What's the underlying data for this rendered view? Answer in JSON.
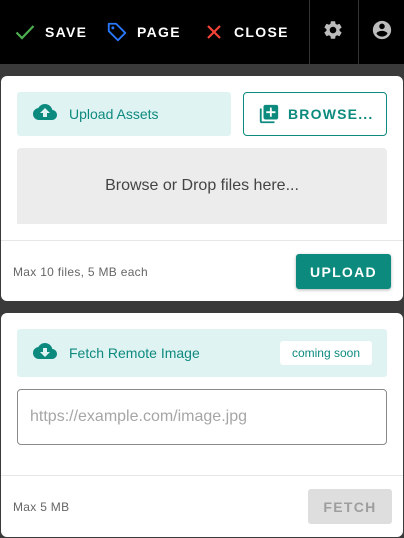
{
  "toolbar": {
    "save_label": "SAVE",
    "page_label": "PAGE",
    "close_label": "CLOSE",
    "icons": [
      "check-icon",
      "tag-icon",
      "close-icon",
      "gear-icon",
      "account-circle-icon"
    ]
  },
  "colors": {
    "toolbar_bg": "#000000",
    "save_icon": "#4caf50",
    "page_icon": "#2979ff",
    "close_icon": "#f44336",
    "accent": "#0d8a7e",
    "tile_bg": "#e0f3f3"
  },
  "upload": {
    "tile_label": "Upload Assets",
    "browse_label": "BROWSE...",
    "dropzone_text": "Browse or Drop files here...",
    "limit_note": "Max 10 files, 5 MB each",
    "upload_label": "UPLOAD"
  },
  "fetch": {
    "tile_label": "Fetch Remote Image",
    "badge": "coming soon",
    "url_placeholder": "https://example.com/image.jpg",
    "url_value": "",
    "limit_note": "Max 5 MB",
    "fetch_label": "FETCH",
    "fetch_disabled": true
  }
}
